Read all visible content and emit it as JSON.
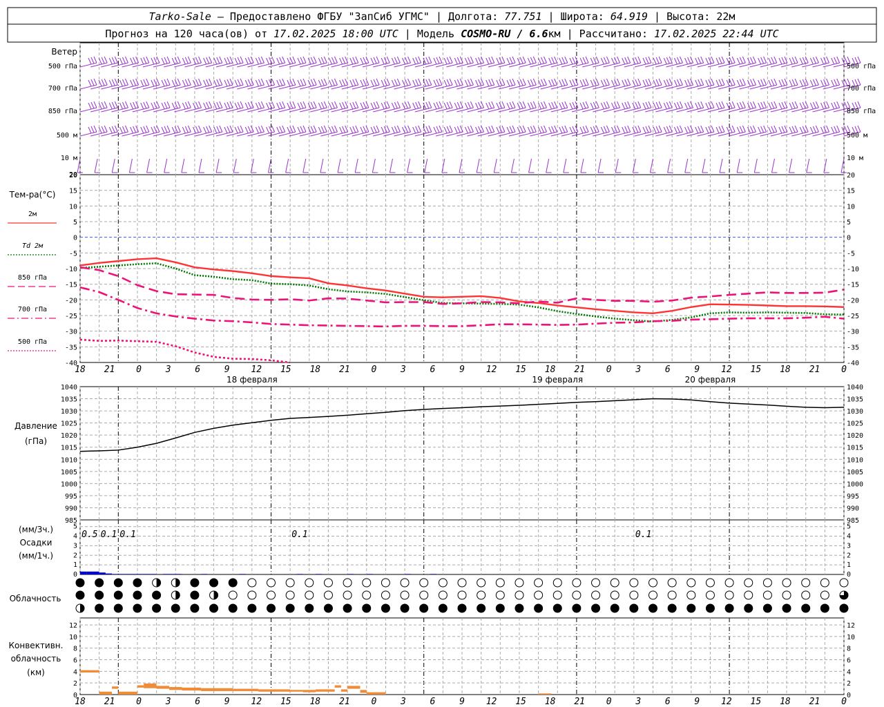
{
  "header": {
    "line1": [
      "Tarko-Sale",
      " – Предоставлено ФГБУ \"ЗапСиб УГМС\" | Долгота: ",
      "77.751",
      " | Широта: ",
      "64.919",
      " | Высота: 22м"
    ],
    "line2": [
      "Прогноз на 120 часа(ов) от ",
      "17.02.2025 18:00 UTC",
      "  | Модель ",
      "COSMO-RU / 6.6",
      "км | Рассчитано: ",
      "17.02.2025 22:44 UTC"
    ]
  },
  "time_axis": {
    "hour_labels": [
      "18",
      "21",
      "0",
      "3",
      "6",
      "9",
      "12",
      "15",
      "18",
      "21",
      "0",
      "3",
      "6",
      "9",
      "12",
      "15",
      "18",
      "21",
      "0",
      "3",
      "6",
      "9",
      "12",
      "15",
      "18",
      "21",
      "0"
    ],
    "day_labels": [
      "18 февраля",
      "19 февраля",
      "20 февраля"
    ]
  },
  "wind_panel": {
    "title": "Ветер",
    "levels": [
      "500 гПа",
      "700 гПа",
      "850 гПа",
      "500 м",
      "10 м"
    ],
    "barb_color": "#9933cc",
    "bottom_label": "20"
  },
  "temp_panel": {
    "title": "Тем-ра(°C)",
    "legend": [
      {
        "label": "2м",
        "color": "#ff3333",
        "style": "solid"
      },
      {
        "label": "Td 2м",
        "color": "#007700",
        "style": "dotted"
      },
      {
        "label": "850 гПа",
        "color": "#ee1177",
        "style": "dashed"
      },
      {
        "label": "700 гПа",
        "color": "#ee1177",
        "style": "dashdot"
      },
      {
        "label": "500 гПа",
        "color": "#ee1177",
        "style": "dotted"
      }
    ]
  },
  "pressure_panel": {
    "title": "Давление",
    "unit": "(гПа)"
  },
  "precip_panel": {
    "labels": [
      "(мм/3ч.)",
      "Осадки",
      "(мм/1ч.)"
    ],
    "ticks": [
      "0",
      "1",
      "2",
      "3",
      "4",
      "5"
    ],
    "amounts": [
      {
        "hour": 1.5,
        "text": "0.5"
      },
      {
        "hour": 4.5,
        "text": "0.1"
      },
      {
        "hour": 7.5,
        "text": "0.1"
      },
      {
        "hour": 34.5,
        "text": "0.1"
      },
      {
        "hour": 88.5,
        "text": "0.1"
      }
    ]
  },
  "cloud_panel": {
    "title": "Облачность"
  },
  "conv_panel": {
    "labels": [
      "Конвективн.",
      "облачность",
      "(км)"
    ]
  },
  "chart_data": [
    {
      "type": "line",
      "title": "Тем-ра(°C)",
      "x_unit": "hours since 17.02.2025 18:00 UTC",
      "ylim": [
        -40,
        20
      ],
      "yticks": [
        20,
        15,
        10,
        5,
        0,
        -5,
        -10,
        -15,
        -20,
        -25,
        -30,
        -35,
        -40
      ],
      "x": [
        0,
        3,
        6,
        9,
        12,
        15,
        18,
        21,
        24,
        27,
        30,
        33,
        36,
        39,
        42,
        45,
        48,
        51,
        54,
        57,
        60,
        63,
        66,
        69,
        72,
        75,
        78,
        81,
        84,
        87,
        90,
        93,
        96,
        99,
        102,
        105,
        108,
        111,
        114,
        117,
        120
      ],
      "series": [
        {
          "name": "2м",
          "color": "#ff3333",
          "values": [
            -9,
            -8.2,
            -7.6,
            -7,
            -6.7,
            -8,
            -9.6,
            -10.3,
            -10.8,
            -11.5,
            -12.4,
            -12.8,
            -13.1,
            -14.7,
            -15.4,
            -16.3,
            -17,
            -18,
            -19,
            -19.2,
            -19,
            -18.8,
            -19.4,
            -20.5,
            -21,
            -21.8,
            -22.4,
            -23,
            -23.5,
            -24,
            -24.3,
            -23.5,
            -22.3,
            -21.4,
            -21.5,
            -21.6,
            -21.8,
            -22,
            -22,
            -22.1,
            -22.3
          ]
        },
        {
          "name": "Td 2м",
          "color": "#007700",
          "values": [
            -9.8,
            -9.4,
            -9,
            -8.6,
            -8.3,
            -10,
            -12.1,
            -12.6,
            -13.4,
            -13.7,
            -14.8,
            -15,
            -15.4,
            -16.6,
            -17.3,
            -17.6,
            -18.1,
            -19.1,
            -20.1,
            -21,
            -21.1,
            -21.2,
            -21.3,
            -21.5,
            -22.4,
            -23.6,
            -24.5,
            -25.3,
            -26,
            -26.5,
            -26.9,
            -26.4,
            -25.6,
            -24.3,
            -24,
            -24.1,
            -24,
            -24.1,
            -24.2,
            -24.6,
            -24.7
          ]
        },
        {
          "name": "850 гПа",
          "color": "#ee1177",
          "values": [
            -9.6,
            -10.5,
            -12.4,
            -15.3,
            -17.2,
            -18.2,
            -18.3,
            -18.4,
            -19.4,
            -19.9,
            -20,
            -19.8,
            -20.2,
            -19.5,
            -19.6,
            -20.2,
            -20.8,
            -20.7,
            -20.7,
            -21.3,
            -21.1,
            -20.7,
            -20.8,
            -21.1,
            -20.5,
            -20.9,
            -19.5,
            -20,
            -20.3,
            -20.3,
            -20.6,
            -20.2,
            -19.3,
            -18.9,
            -18.4,
            -18,
            -17.6,
            -17.8,
            -17.8,
            -17.7,
            -16.7
          ]
        },
        {
          "name": "700 гПа",
          "color": "#ee1177",
          "values": [
            -16,
            -17.5,
            -20,
            -22.6,
            -24.3,
            -25.3,
            -26,
            -26.6,
            -26.8,
            -27.2,
            -27.7,
            -27.9,
            -28.1,
            -28.2,
            -28.3,
            -28.4,
            -28.5,
            -28.3,
            -28.3,
            -28.4,
            -28.4,
            -28.1,
            -27.8,
            -27.8,
            -27.9,
            -28,
            -27.9,
            -27.6,
            -27.3,
            -27.2,
            -26.8,
            -26.7,
            -26.3,
            -26.2,
            -26,
            -25.9,
            -25.9,
            -25.9,
            -25.7,
            -25.4,
            -26
          ]
        },
        {
          "name": "500 гПа",
          "color": "#ee1177",
          "values": [
            -32.7,
            -33.1,
            -33,
            -33.2,
            -33.4,
            -34.8,
            -36.8,
            -38.2,
            -38.8,
            -38.9,
            -39.3,
            -40
          ]
        }
      ]
    },
    {
      "type": "line",
      "title": "Давление",
      "x_unit": "hours since 17.02.2025 18:00 UTC",
      "ylim": [
        985,
        1040
      ],
      "yticks": [
        1040,
        1035,
        1030,
        1025,
        1020,
        1015,
        1010,
        1005,
        1000,
        995,
        990,
        985
      ],
      "x": [
        0,
        3,
        6,
        9,
        12,
        15,
        18,
        21,
        24,
        27,
        30,
        33,
        36,
        39,
        42,
        45,
        48,
        51,
        54,
        57,
        60,
        63,
        66,
        69,
        72,
        75,
        78,
        81,
        84,
        87,
        90,
        93,
        96,
        99,
        102,
        105,
        108,
        111,
        114,
        117,
        120
      ],
      "series": [
        {
          "name": "Давление",
          "color": "#000000",
          "values": [
            1013.3,
            1013.5,
            1013.8,
            1015,
            1016.6,
            1018.8,
            1021.1,
            1022.8,
            1024.1,
            1025.1,
            1026.1,
            1026.9,
            1027.3,
            1027.7,
            1028.2,
            1028.8,
            1029.4,
            1030.1,
            1030.6,
            1031,
            1031.3,
            1031.7,
            1032,
            1032.3,
            1032.7,
            1033.1,
            1033.5,
            1033.8,
            1034.2,
            1034.6,
            1035,
            1034.9,
            1034.5,
            1033.8,
            1033.2,
            1032.8,
            1032.4,
            1031.9,
            1031.5,
            1031.3,
            1031.5
          ]
        }
      ]
    },
    {
      "type": "bar",
      "title": "Осадки",
      "x_unit": "hours since 17.02.2025 18:00 UTC",
      "ylim": [
        0,
        5
      ],
      "x": [
        1,
        2,
        3,
        4,
        5,
        6,
        7,
        8,
        9,
        10,
        11,
        12,
        14,
        15,
        16,
        20,
        26,
        35,
        38,
        43,
        46,
        52,
        56
      ],
      "series": [
        {
          "name": "мм/1ч",
          "color": "#0000cc",
          "values": [
            0.3,
            0.3,
            0.3,
            0.2,
            0.1,
            0.05,
            0.05,
            0.05,
            0.05,
            0.05,
            0.05,
            0.05,
            0.05,
            0.05,
            0.05,
            0.05,
            0.05,
            0.05,
            0.05,
            0.05,
            0.05,
            0.05,
            0.05
          ]
        }
      ]
    },
    {
      "type": "heatmap",
      "title": "Облачность",
      "x_unit": "hours since 17.02.2025 18:00 UTC",
      "x": [
        0,
        3,
        6,
        9,
        12,
        15,
        18,
        21,
        24,
        27,
        30,
        33,
        36,
        39,
        42,
        45,
        48,
        51,
        54,
        57,
        60,
        63,
        66,
        69,
        72,
        75,
        78,
        81,
        84,
        87,
        90,
        93,
        96,
        99,
        102,
        105,
        108,
        111,
        114,
        117,
        120
      ],
      "series": [
        {
          "name": "upper",
          "values_eighths": [
            8,
            8,
            8,
            8,
            4,
            4,
            8,
            8,
            8,
            0,
            0,
            0,
            0,
            0,
            0,
            0,
            0,
            0,
            0,
            0,
            0,
            0,
            0,
            0,
            0,
            0,
            0,
            0,
            0,
            0,
            0,
            0,
            0,
            0,
            0,
            0,
            0,
            0,
            0,
            0,
            0
          ]
        },
        {
          "name": "middle",
          "values_eighths": [
            8,
            8,
            8,
            8,
            8,
            4,
            8,
            4,
            0,
            0,
            0,
            0,
            0,
            0,
            0,
            0,
            0,
            0,
            0,
            0,
            0,
            0,
            0,
            0,
            0,
            0,
            0,
            0,
            0,
            0,
            0,
            0,
            0,
            0,
            0,
            0,
            0,
            0,
            0,
            0,
            6
          ]
        },
        {
          "name": "lower",
          "values_eighths": [
            4,
            8,
            8,
            8,
            8,
            8,
            8,
            8,
            8,
            8,
            8,
            8,
            8,
            8,
            8,
            8,
            8,
            8,
            8,
            8,
            8,
            8,
            8,
            8,
            8,
            8,
            8,
            8,
            8,
            8,
            8,
            8,
            8,
            8,
            8,
            8,
            8,
            8,
            8,
            8,
            8
          ]
        }
      ]
    },
    {
      "type": "bar",
      "title": "Конвективн. облачность (км)",
      "x_unit": "hours since 17.02.2025 18:00 UTC",
      "ylim": [
        0,
        13
      ],
      "yticks": [
        0,
        2,
        4,
        6,
        8,
        10,
        12
      ],
      "bars": [
        {
          "start": 0,
          "end": 3,
          "top": 4.2,
          "base": 3.8
        },
        {
          "start": 3,
          "end": 5,
          "top": 0.5,
          "base": 0
        },
        {
          "start": 5,
          "end": 6,
          "top": 1.4,
          "base": 1
        },
        {
          "start": 6,
          "end": 9,
          "top": 0.5,
          "base": 0
        },
        {
          "start": 9,
          "end": 10,
          "top": 1.6,
          "base": 1.2
        },
        {
          "start": 10,
          "end": 12,
          "top": 1.9,
          "base": 1.1
        },
        {
          "start": 12,
          "end": 14,
          "top": 1.5,
          "base": 1
        },
        {
          "start": 14,
          "end": 16,
          "top": 1.3,
          "base": 0.8
        },
        {
          "start": 16,
          "end": 19,
          "top": 1.2,
          "base": 0.7
        },
        {
          "start": 19,
          "end": 24,
          "top": 1.1,
          "base": 0.6
        },
        {
          "start": 24,
          "end": 28,
          "top": 1,
          "base": 0.6
        },
        {
          "start": 28,
          "end": 33,
          "top": 0.9,
          "base": 0.5
        },
        {
          "start": 33,
          "end": 35,
          "top": 0.8,
          "base": 0.5
        },
        {
          "start": 35,
          "end": 37,
          "top": 0.8,
          "base": 0.4
        },
        {
          "start": 37,
          "end": 40,
          "top": 0.9,
          "base": 0.5
        },
        {
          "start": 40,
          "end": 41,
          "top": 1.6,
          "base": 1.2
        },
        {
          "start": 41,
          "end": 42,
          "top": 0.9,
          "base": 0.5
        },
        {
          "start": 42,
          "end": 44,
          "top": 1.5,
          "base": 1
        },
        {
          "start": 44,
          "end": 45,
          "top": 0.8,
          "base": 0.3
        },
        {
          "start": 45,
          "end": 48,
          "top": 0.4,
          "base": 0
        },
        {
          "start": 72,
          "end": 74,
          "top": 0.2,
          "base": 0
        }
      ]
    }
  ]
}
